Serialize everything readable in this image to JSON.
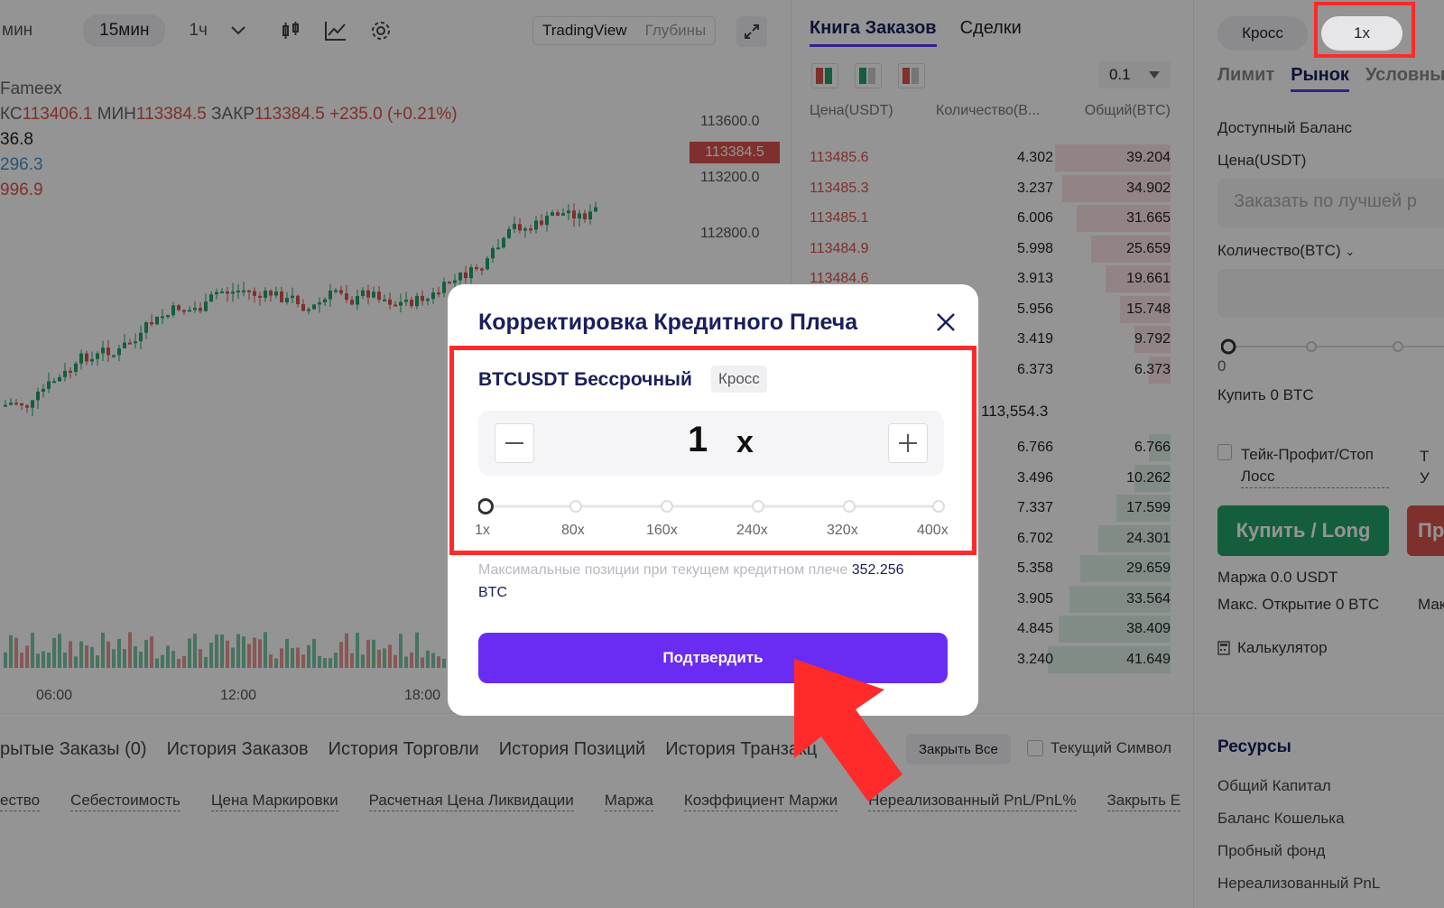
{
  "toolbar": {
    "tf_min_cut": "мин",
    "tf_15m": "15мин",
    "tf_1h": "1ч",
    "view_tradingview": "TradingView",
    "view_depth": "Глубины"
  },
  "chart": {
    "brand": "Fameex",
    "ohlc_prefix_max": "КС",
    "ohlc_max": "113406.1",
    "ohlc_label_min": "МИН",
    "ohlc_min": "113384.5",
    "ohlc_label_close": "ЗАКР",
    "ohlc_close": "113384.5",
    "ohlc_change": "+235.0 (+0.21%)",
    "ma1": "36.8",
    "ma2": "296.3",
    "ma3": "996.9",
    "y_labels": [
      "113600.0",
      "113200.0",
      "112800.0"
    ],
    "current_price": "113384.5",
    "x_labels": [
      "06:00",
      "12:00",
      "18:00"
    ]
  },
  "orderbook": {
    "tab_book": "Книга Заказов",
    "tab_trades": "Сделки",
    "step": "0.1",
    "col_price": "Цена(USDT)",
    "col_qty": "Количество(В...",
    "col_total": "Общий(BTC)",
    "asks": [
      {
        "p": "113485.6",
        "q": "4.302",
        "t": "39.204"
      },
      {
        "p": "113485.3",
        "q": "3.237",
        "t": "34.902"
      },
      {
        "p": "113485.1",
        "q": "6.006",
        "t": "31.665"
      },
      {
        "p": "113484.9",
        "q": "5.998",
        "t": "25.659"
      },
      {
        "p": "113484.6",
        "q": "3.913",
        "t": "19.661"
      },
      {
        "p": "",
        "q": "5.956",
        "t": "15.748"
      },
      {
        "p": "",
        "q": "3.419",
        "t": "9.792"
      },
      {
        "p": "",
        "q": "6.373",
        "t": "6.373"
      }
    ],
    "mid": "113,554.3",
    "bids": [
      {
        "q": "6.766",
        "t": "6.766"
      },
      {
        "q": "3.496",
        "t": "10.262"
      },
      {
        "q": "7.337",
        "t": "17.599"
      },
      {
        "q": "6.702",
        "t": "24.301"
      },
      {
        "q": "5.358",
        "t": "29.659"
      },
      {
        "q": "3.905",
        "t": "33.564"
      },
      {
        "q": "4.845",
        "t": "38.409"
      },
      {
        "q": "3.240",
        "t": "41.649"
      }
    ]
  },
  "trade_panel": {
    "margin_mode": "Кросс",
    "leverage": "1x",
    "tab_limit": "Лимит",
    "tab_market": "Рынок",
    "tab_conditional": "Условный",
    "available_balance": "Доступный Баланс",
    "price_label": "Цена(USDT)",
    "price_placeholder": "Заказать по лучшей р",
    "qty_label": "Количество(BTC)",
    "slider_zero": "0",
    "buy_amount": "Купить 0 BTC",
    "tp_sl": "Тейк-Профит/Стоп Лосс",
    "tp_sl_cut": "Т У",
    "buy_long": "Купить / Long",
    "sell_cut": "Пр",
    "margin": "Маржа 0.0 USDT",
    "max_open": "Макс. Открытие 0 BTC",
    "max_cut": "Мак",
    "calculator": "Калькулятор"
  },
  "resources": {
    "title": "Ресурсы",
    "items": [
      "Общий Капитал",
      "Баланс Кошелька",
      "Пробный фонд",
      "Нереализованный PnL"
    ]
  },
  "bottom": {
    "tabs": [
      "рытые Заказы (0)",
      "История Заказов",
      "История Торговли",
      "История Позиций",
      "История Транзакц"
    ],
    "close_all": "Закрыть Все",
    "current_symbol": "Текущий Символ",
    "cols": [
      "ество",
      "Себестоимость",
      "Цена Маркировки",
      "Расчетная Цена Ликвидации",
      "Маржа",
      "Коэффициент Маржи",
      "Нереализованный PnL/PnL%",
      "Закрыть Е"
    ]
  },
  "modal": {
    "title": "Корректировка Кредитного Плеча",
    "symbol": "BTCUSDT Бессрочный",
    "badge": "Кросс",
    "value": "1",
    "x": "x",
    "ticks": [
      "1x",
      "80x",
      "160x",
      "240x",
      "320x",
      "400x"
    ],
    "max_text": "Максимальные позиции при текущем кредитном плече",
    "max_value": "352.256",
    "max_unit": "BTC",
    "confirm": "Подтвердить"
  },
  "colors": {
    "accent": "#6a2cf2",
    "highlight": "#ff2a2a",
    "buy": "#23a36b",
    "sell": "#d9534f"
  }
}
